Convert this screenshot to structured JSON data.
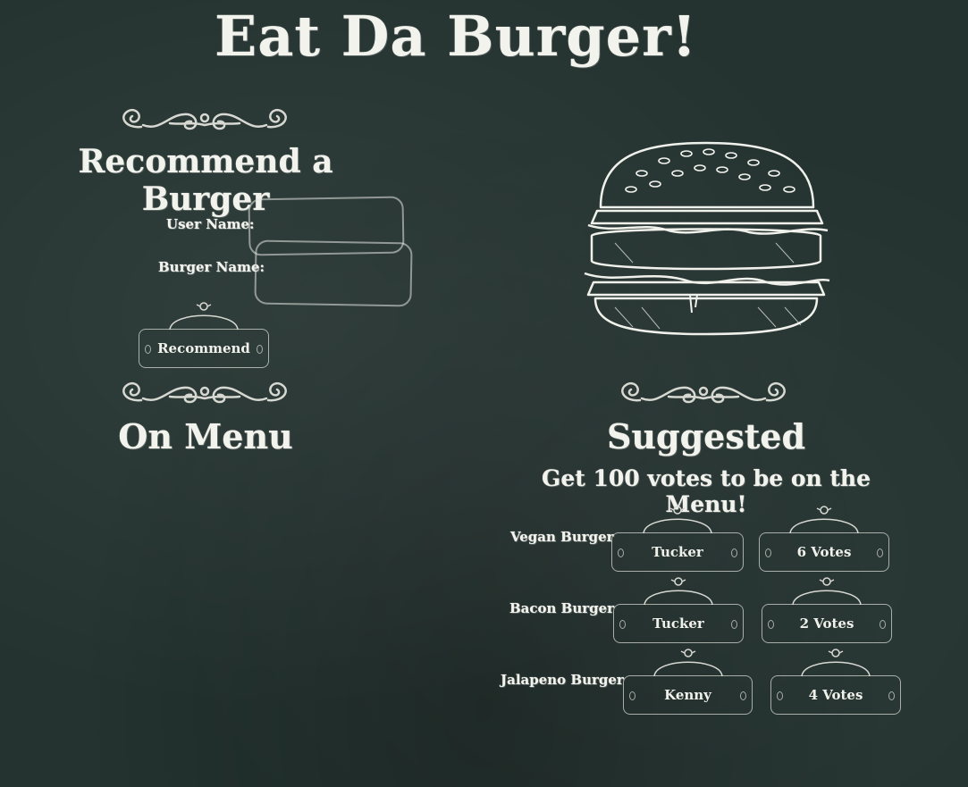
{
  "header": {
    "title": "Eat Da Burger!"
  },
  "recommend": {
    "title": "Recommend a Burger",
    "user_name_label": "User Name:",
    "burger_name_label": "Burger Name:",
    "user_name_value": "",
    "burger_name_value": "",
    "button_label": "Recommend"
  },
  "on_menu": {
    "title": "On Menu"
  },
  "suggested": {
    "title": "Suggested",
    "subtitle": "Get 100 votes to be on the Menu!",
    "items": [
      {
        "name": "Vegan Burger",
        "user": "Tucker",
        "votes": "6 Votes"
      },
      {
        "name": "Bacon Burger",
        "user": "Tucker",
        "votes": "2 Votes"
      },
      {
        "name": "Jalapeno Burger",
        "user": "Kenny",
        "votes": "4 Votes"
      }
    ]
  },
  "icons": {
    "flourish": "ornament-flourish-icon",
    "burger": "burger-illustration-icon",
    "cloche": "cloche-icon"
  },
  "colors": {
    "background": "#243330",
    "chalk": "#f1f1ec"
  }
}
